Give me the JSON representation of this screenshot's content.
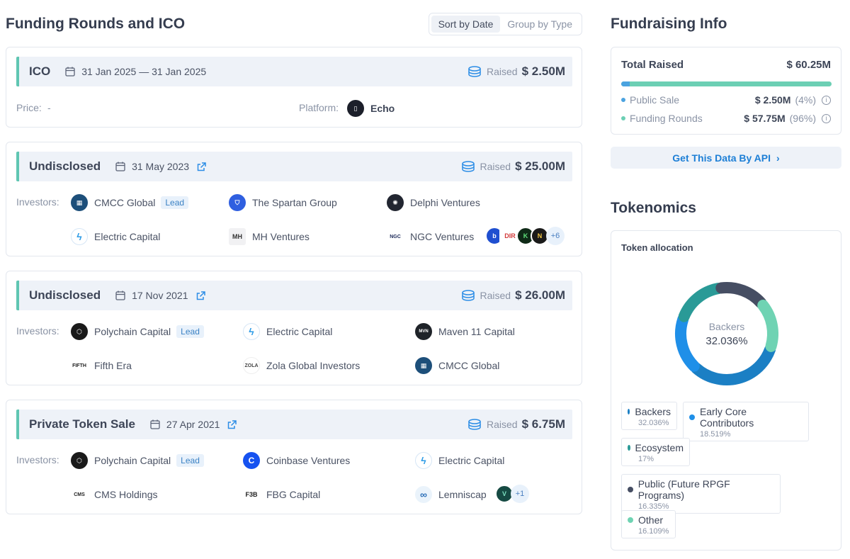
{
  "left": {
    "title": "Funding Rounds and ICO",
    "sort_by_date": "Sort by Date",
    "group_by_type": "Group by Type",
    "raised_label": "Raised",
    "investors_label": "Investors:",
    "lead_label": "Lead",
    "ico": {
      "title": "ICO",
      "date": "31 Jan 2025 — 31 Jan 2025",
      "amount": "$ 2.50M",
      "price_label": "Price:",
      "price_value": "-",
      "platform_label": "Platform:",
      "platform_value": "Echo"
    },
    "round1": {
      "title": "Undisclosed",
      "date": "31 May 2023",
      "amount": "$ 25.00M",
      "investors": [
        "CMCC Global",
        "The Spartan Group",
        "Delphi Ventures",
        "Electric Capital",
        "MH Ventures",
        "NGC Ventures"
      ],
      "more": "+6"
    },
    "round2": {
      "title": "Undisclosed",
      "date": "17 Nov 2021",
      "amount": "$ 26.00M",
      "investors": [
        "Polychain Capital",
        "Electric Capital",
        "Maven 11 Capital",
        "Fifth Era",
        "Zola Global Investors",
        "CMCC Global"
      ]
    },
    "round3": {
      "title": "Private Token Sale",
      "date": "27 Apr 2021",
      "amount": "$ 6.75M",
      "investors": [
        "Polychain Capital",
        "Coinbase Ventures",
        "Electric Capital",
        "CMS Holdings",
        "FBG Capital",
        "Lemniscap"
      ],
      "more": "+1"
    }
  },
  "right": {
    "fund_title": "Fundraising Info",
    "total_label": "Total Raised",
    "total_value": "$ 60.25M",
    "public_sale_label": "Public Sale",
    "public_sale_value": "$ 2.50M",
    "public_sale_pct": "(4%)",
    "funding_rounds_label": "Funding Rounds",
    "funding_rounds_value": "$ 57.75M",
    "funding_rounds_pct": "(96%)",
    "public_sale_fraction": 0.04,
    "api_button": "Get This Data By API",
    "tokenomics_title": "Tokenomics",
    "alloc_title": "Token allocation",
    "center_label": "Backers",
    "center_value": "32.036%",
    "allocation": [
      {
        "name": "Backers",
        "pct": "32.036%",
        "value": 32.036,
        "color": "#1b7fc4"
      },
      {
        "name": "Early Core Contributors",
        "pct": "18.519%",
        "value": 18.519,
        "color": "#1f8fe8"
      },
      {
        "name": "Ecosystem",
        "pct": "17%",
        "value": 17,
        "color": "#2a9a97"
      },
      {
        "name": "Public (Future RPGF Programs)",
        "pct": "16.335%",
        "value": 16.335,
        "color": "#464e63"
      },
      {
        "name": "Other",
        "pct": "16.109%",
        "value": 16.109,
        "color": "#6fd3b3"
      }
    ]
  },
  "colors": {
    "accent": "#1d7fd6",
    "teal": "#5fc6b2",
    "bar": "#6ccfb4"
  }
}
